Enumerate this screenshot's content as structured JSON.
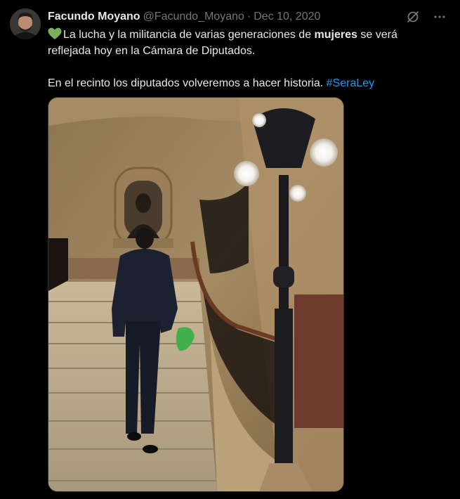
{
  "tweet": {
    "author": {
      "name": "Facundo Moyano",
      "handle": "@Facundo_Moyano",
      "separator": "·",
      "date": "Dec 10, 2020"
    },
    "text": {
      "emoji": "green-heart",
      "line1_before": "La lucha y la militancia de varias generaciones de ",
      "line1_bold": "mujeres",
      "line1_after": " se verá reflejada hoy en la Cámara de Diputados.",
      "line2": "En el recinto los diputados volveremos a hacer historia. ",
      "hashtag": "#SeraLey"
    },
    "media": {
      "type": "photo",
      "icon": "photo-icon"
    },
    "actions": {
      "grok_icon": "grok-icon",
      "more_icon": "more-icon"
    },
    "colors": {
      "background": "#000000",
      "text": "#e7e9ea",
      "secondary": "#71767b",
      "link": "#1d9bf0",
      "heart": "#78b159"
    }
  }
}
